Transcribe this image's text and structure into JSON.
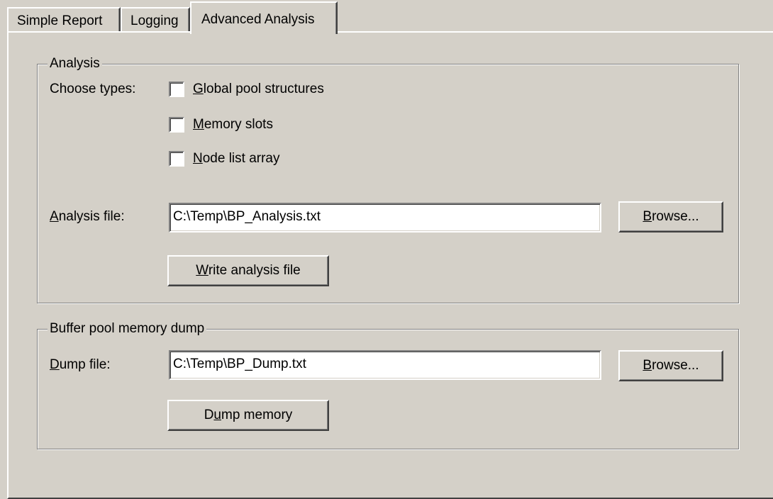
{
  "tabs": [
    {
      "label": "Simple Report",
      "selected": false
    },
    {
      "label": "Logging",
      "selected": false
    },
    {
      "label": "Advanced Analysis",
      "selected": true
    }
  ],
  "analysis": {
    "title": "Analysis",
    "choose_types_label": "Choose types:",
    "checkboxes": [
      {
        "mnemonic": "G",
        "rest": "lobal pool structures",
        "checked": false
      },
      {
        "mnemonic": "M",
        "rest": "emory slots",
        "checked": false
      },
      {
        "mnemonic": "N",
        "rest": "ode list array",
        "checked": false
      }
    ],
    "file_label_mnemonic": "A",
    "file_label_rest": "nalysis file:",
    "file_value": "C:\\Temp\\BP_Analysis.txt",
    "browse_mnemonic": "B",
    "browse_rest": "rowse...",
    "write_mnemonic": "W",
    "write_rest": "rite analysis file"
  },
  "dump": {
    "title": "Buffer pool memory dump",
    "file_label_mnemonic": "D",
    "file_label_rest": "ump file:",
    "file_value": "C:\\Temp\\BP_Dump.txt",
    "browse_mnemonic": "B",
    "browse_rest": "rowse...",
    "dump_pre": "D",
    "dump_mnemonic": "u",
    "dump_post": "mp memory"
  },
  "colors": {
    "face": "#d4d0c8",
    "highlight": "#ffffff",
    "shadow": "#808080",
    "dark_shadow": "#404040"
  }
}
